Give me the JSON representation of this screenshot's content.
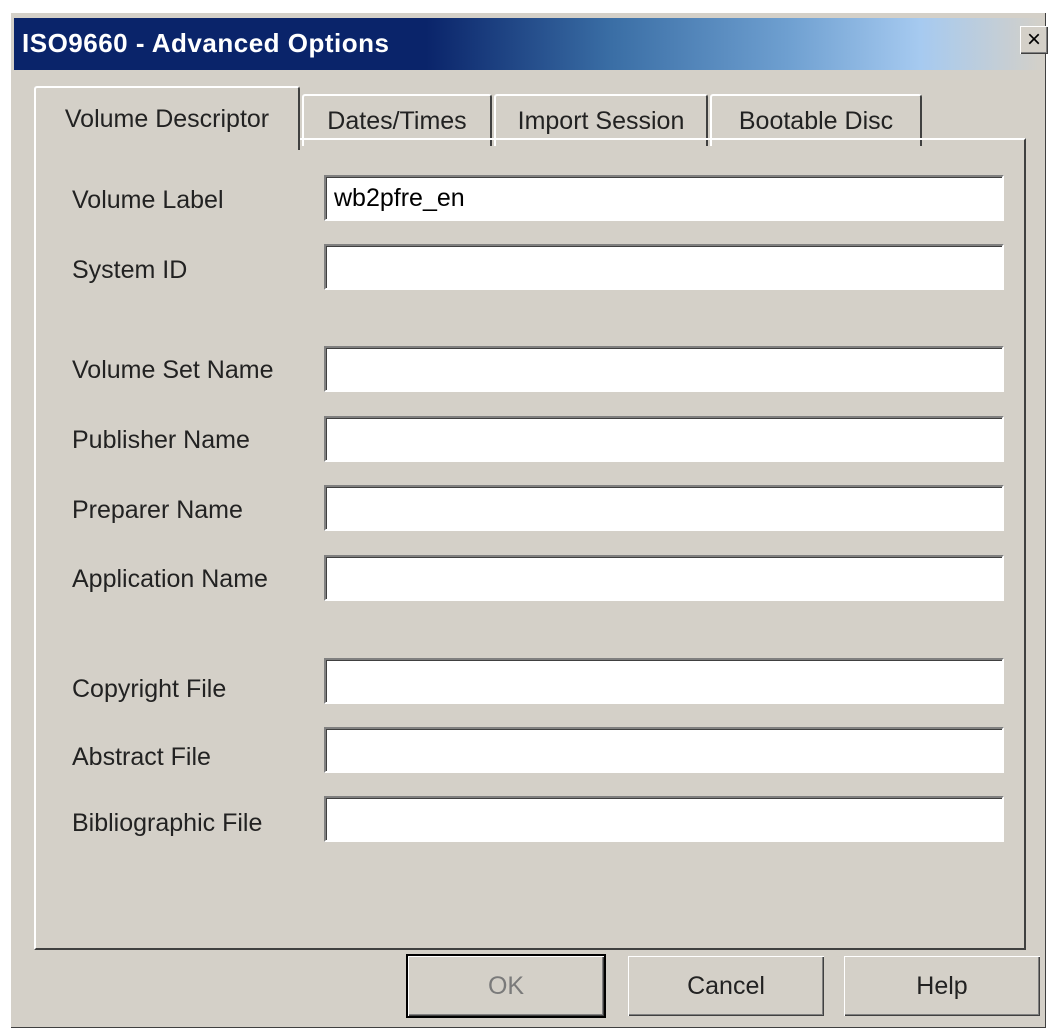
{
  "window": {
    "title": "ISO9660 - Advanced Options",
    "close_label": "×"
  },
  "tabs": [
    {
      "label": "Volume Descriptor",
      "active": true
    },
    {
      "label": "Dates/Times",
      "active": false
    },
    {
      "label": "Import Session",
      "active": false
    },
    {
      "label": "Bootable Disc",
      "active": false
    }
  ],
  "fields": {
    "volume_label": {
      "label": "Volume Label",
      "value": "wb2pfre_en"
    },
    "system_id": {
      "label": "System ID",
      "value": ""
    },
    "volume_set_name": {
      "label": "Volume Set Name",
      "value": ""
    },
    "publisher_name": {
      "label": "Publisher Name",
      "value": ""
    },
    "preparer_name": {
      "label": "Preparer Name",
      "value": ""
    },
    "application_name": {
      "label": "Application Name",
      "value": ""
    },
    "copyright_file": {
      "label": "Copyright File",
      "value": ""
    },
    "abstract_file": {
      "label": "Abstract File",
      "value": ""
    },
    "bibliographic_file": {
      "label": "Bibliographic File",
      "value": ""
    }
  },
  "buttons": {
    "ok": "OK",
    "cancel": "Cancel",
    "help": "Help"
  }
}
